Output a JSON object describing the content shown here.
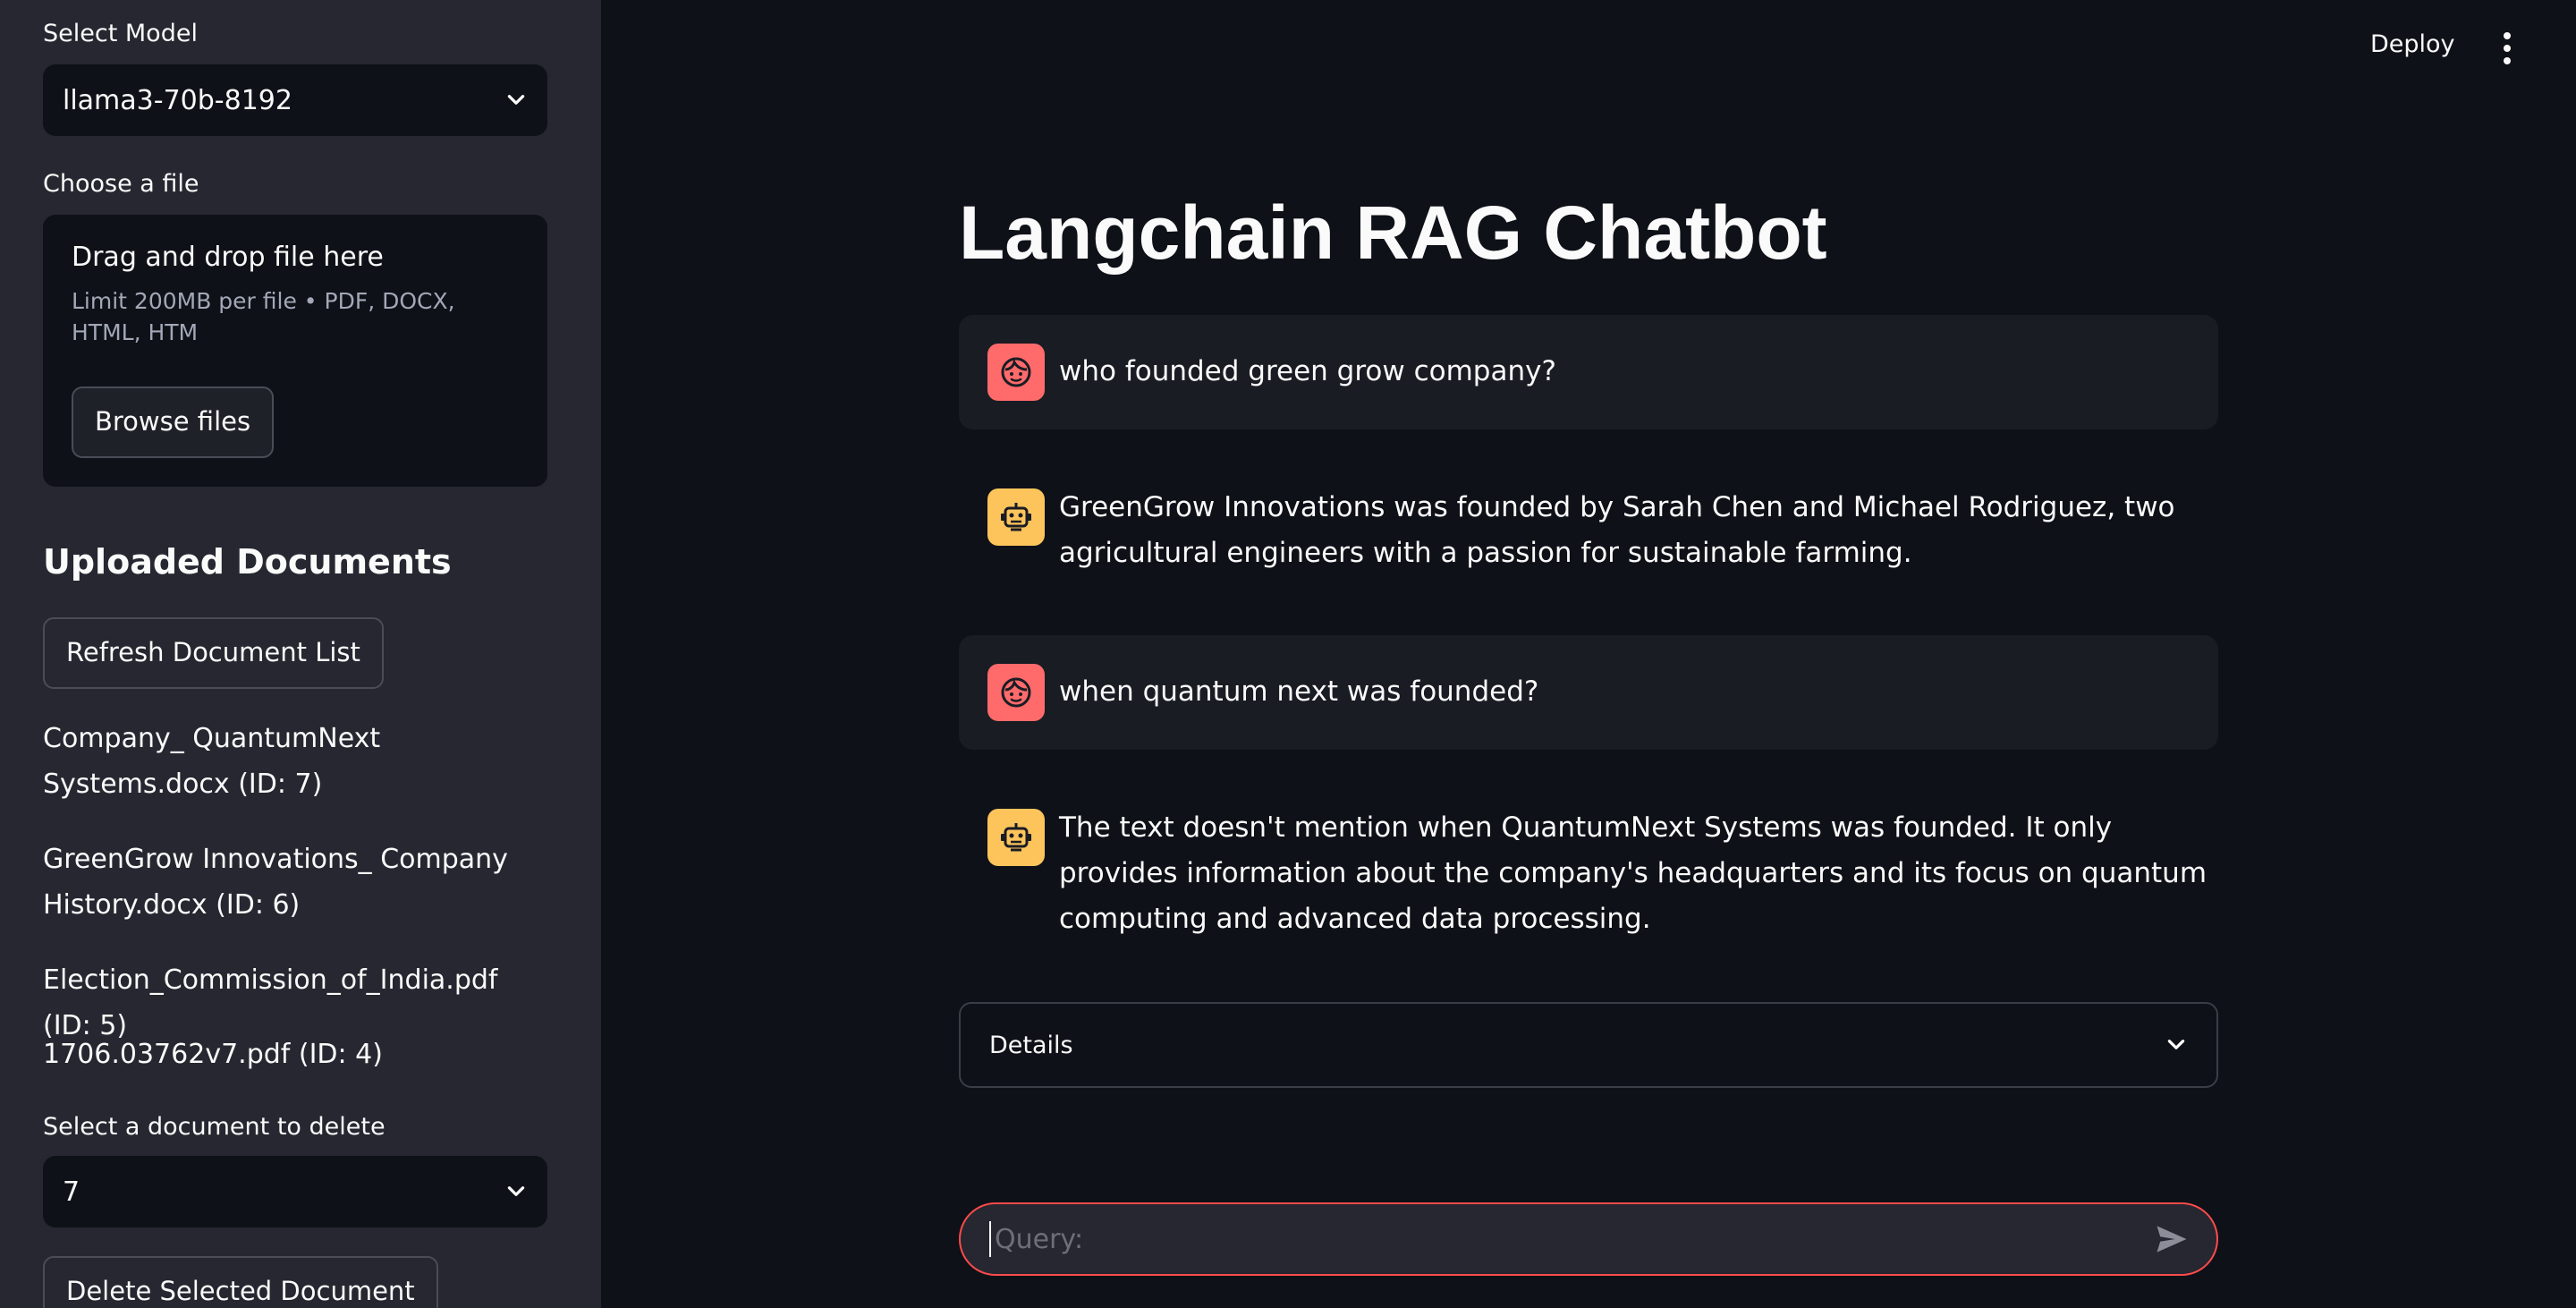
{
  "sidebar": {
    "model_label": "Select Model",
    "model_value": "llama3-70b-8192",
    "file_label": "Choose a file",
    "uploader": {
      "title": "Drag and drop file here",
      "limit": "Limit 200MB per file • PDF, DOCX, HTML, HTM",
      "browse": "Browse files"
    },
    "uploaded_title": "Uploaded Documents",
    "refresh_button": "Refresh Document List",
    "documents": [
      "Company_ QuantumNext Systems.docx (ID: 7)",
      "GreenGrow Innovations_ Company History.docx (ID: 6)",
      "Election_Commission_of_India.pdf (ID: 5)",
      "1706.03762v7.pdf (ID: 4)"
    ],
    "delete_label": "Select a document to delete",
    "delete_value": "7",
    "delete_button": "Delete Selected Document"
  },
  "header": {
    "deploy": "Deploy"
  },
  "main": {
    "title": "Langchain RAG Chatbot",
    "messages": [
      {
        "role": "user",
        "text": "who founded green grow company?"
      },
      {
        "role": "assistant",
        "text": "GreenGrow Innovations was founded by Sarah Chen and Michael Rodriguez, two agricultural engineers with a passion for sustainable farming."
      },
      {
        "role": "user",
        "text": "when quantum next was founded?"
      },
      {
        "role": "assistant",
        "text": "The text doesn't mention when QuantumNext Systems was founded. It only provides information about the company's headquarters and its focus on quantum computing and advanced data processing."
      }
    ],
    "details": "Details",
    "input": {
      "placeholder": "Query:",
      "value": ""
    }
  },
  "colors": {
    "accent": "#ff4b4b",
    "user_avatar": "#ff6b6b",
    "bot_avatar": "#fdc45c",
    "sidebar_bg": "#262730",
    "main_bg": "#0e1117"
  },
  "icons": {
    "user_avatar": "face-icon",
    "bot_avatar": "robot-icon",
    "send": "send-icon",
    "select": "chevron-down-icon",
    "menu": "kebab-menu-icon"
  }
}
